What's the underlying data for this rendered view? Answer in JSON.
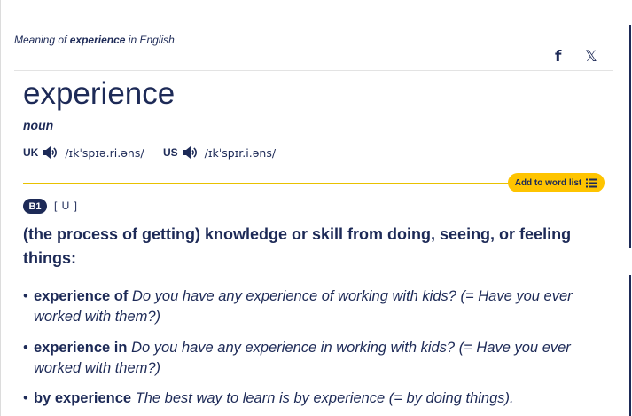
{
  "breadcrumb": {
    "prefix": "Meaning of",
    "word": "experience",
    "suffix": "in English"
  },
  "share": {
    "facebook_icon": "f",
    "x_icon": "𝕏"
  },
  "entry": {
    "headword": "experience",
    "pos": "noun",
    "uk": {
      "region": "UK",
      "ipa": "/ɪkˈspɪə.ri.əns/"
    },
    "us": {
      "region": "US",
      "ipa": "/ɪkˈspɪr.i.əns/"
    },
    "add_to_word_list": "Add to word list",
    "level": "B1",
    "grammar": "[ U ]",
    "definition": "(the process of getting) knowledge or skill from doing, seeing, or feeling things:",
    "examples": [
      {
        "lu": "experience of",
        "text": "Do you have any experience of working with kids? (= Have you ever worked with them?)"
      },
      {
        "lu": "experience in",
        "text": "Do you have any experience in working with kids? (= Have you ever worked with them?)"
      },
      {
        "lu": "by experience",
        "text": "The best way to learn is by experience (= by doing things)."
      }
    ]
  },
  "colors": {
    "primary": "#1d2a57",
    "accent": "#fec400"
  }
}
